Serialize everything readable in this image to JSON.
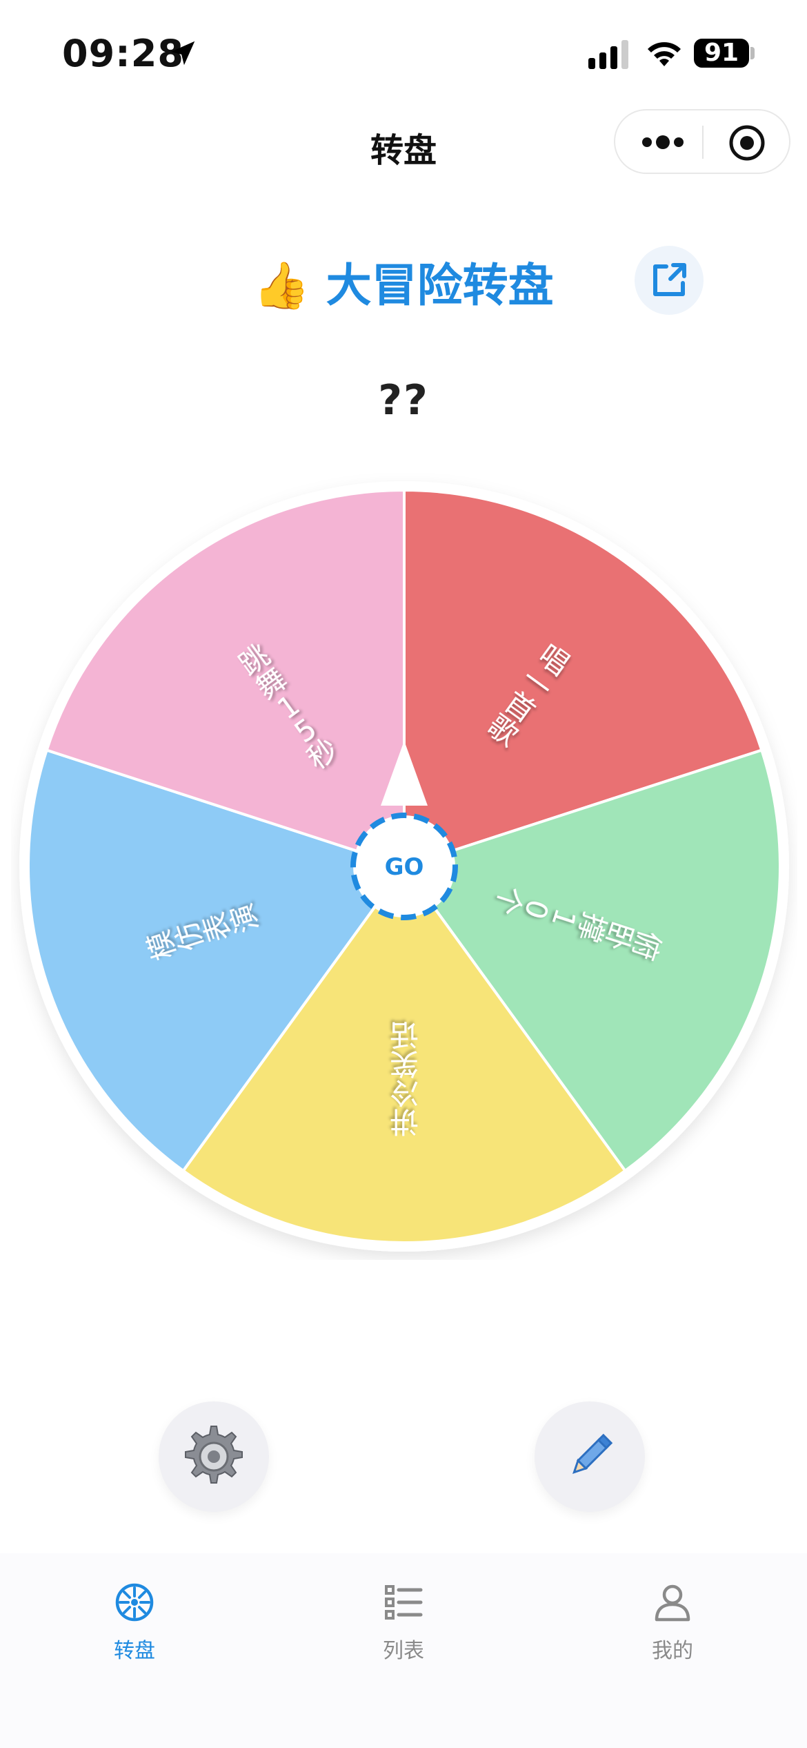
{
  "status_bar": {
    "time": "09:28",
    "battery": "91"
  },
  "nav": {
    "title": "转盘"
  },
  "header": {
    "title": "👍 大冒险转盘"
  },
  "result": {
    "text": "??"
  },
  "wheel": {
    "center_label": "GO",
    "segments": [
      {
        "label": "唱一首歌",
        "color": "#E97173"
      },
      {
        "label": "俯卧撑10个",
        "color": "#A0E5B8"
      },
      {
        "label": "讲冷笑话",
        "color": "#F7E478"
      },
      {
        "label": "模仿表演",
        "color": "#8ECBF6"
      },
      {
        "label": "跳舞15秒",
        "color": "#F4B4D4"
      }
    ]
  },
  "tabs": [
    {
      "label": "转盘",
      "active": true
    },
    {
      "label": "列表",
      "active": false
    },
    {
      "label": "我的",
      "active": false
    }
  ],
  "colors": {
    "accent": "#1F8AE0",
    "inactive": "#8A8A8A"
  }
}
